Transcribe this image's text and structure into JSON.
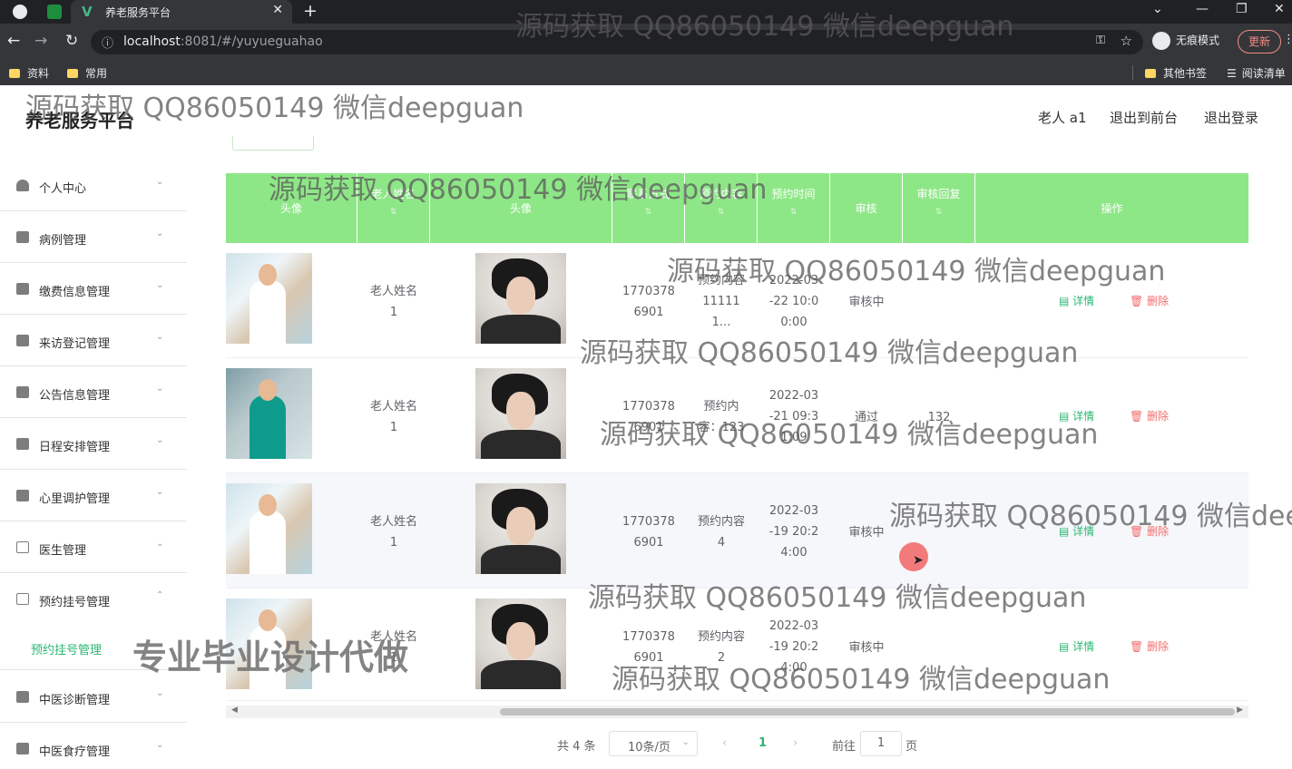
{
  "browser": {
    "tab_title": "养老服务平台",
    "url_host": "localhost",
    "url_rest": ":8081/#/yuyueguahao",
    "incognito_label": "无痕模式",
    "update_label": "更新",
    "bookmarks": [
      "资料",
      "常用"
    ],
    "bookmarks_right": [
      "其他书签",
      "阅读清单"
    ]
  },
  "app": {
    "title": "养老服务平台",
    "user": "老人 a1",
    "back_front": "退出到前台",
    "logout": "退出登录"
  },
  "sidebar": {
    "items": [
      {
        "label": "个人中心",
        "icon": "user-icon"
      },
      {
        "label": "病例管理",
        "icon": "grid-icon"
      },
      {
        "label": "缴费信息管理",
        "icon": "monitor-icon"
      },
      {
        "label": "来访登记管理",
        "icon": "chart-icon"
      },
      {
        "label": "公告信息管理",
        "icon": "briefcase-icon"
      },
      {
        "label": "日程安排管理",
        "icon": "camera-icon"
      },
      {
        "label": "心里调护管理",
        "icon": "clipboard-icon"
      },
      {
        "label": "医生管理",
        "icon": "mail-icon"
      },
      {
        "label": "预约挂号管理",
        "icon": "message-icon"
      },
      {
        "label": "中医诊断管理",
        "icon": "list-icon"
      },
      {
        "label": "中医食疗管理",
        "icon": "monitor-icon"
      }
    ],
    "submenu_active": "预约挂号管理"
  },
  "table": {
    "headers": [
      "头像",
      "老人姓名",
      "头像",
      "联系方式",
      "预约内容",
      "预约时间",
      "审核",
      "审核回复",
      "操作"
    ],
    "rows": [
      {
        "name": [
          "老人姓名",
          "1"
        ],
        "contact": [
          "1770378",
          "6901"
        ],
        "content": [
          "预约内容",
          "11111",
          "1..."
        ],
        "time": [
          "2022-03",
          "-22 10:0",
          "0:00"
        ],
        "status": "审核中",
        "reply": ""
      },
      {
        "name": [
          "老人姓名",
          "1"
        ],
        "contact": [
          "1770378",
          "6901"
        ],
        "content": [
          "预约内",
          "容：123"
        ],
        "time": [
          "2022-03",
          "-21 09:3",
          "1:09"
        ],
        "status": "通过",
        "reply": "132"
      },
      {
        "name": [
          "老人姓名",
          "1"
        ],
        "contact": [
          "1770378",
          "6901"
        ],
        "content": [
          "预约内容",
          "4"
        ],
        "time": [
          "2022-03",
          "-19 20:2",
          "4:00"
        ],
        "status": "审核中",
        "reply": ""
      },
      {
        "name": [
          "老人姓名",
          "1"
        ],
        "contact": [
          "1770378",
          "6901"
        ],
        "content": [
          "预约内容",
          "2"
        ],
        "time": [
          "2022-03",
          "-19 20:2",
          "4:00"
        ],
        "status": "审核中",
        "reply": ""
      }
    ],
    "detail_label": "详情",
    "delete_label": "删除"
  },
  "pagination": {
    "total": "共 4 条",
    "page_size": "10条/页",
    "current": "1",
    "goto_label": "前往",
    "goto_value": "1",
    "page_unit": "页"
  },
  "watermarks": {
    "qq": "源码获取 QQ86050149 微信deepguan",
    "qq_cut": "源码获取 QQ86050149 微信dee",
    "promo": "专业毕业设计代做"
  },
  "colors": {
    "accent": "#2bb673",
    "header_bg": "#8ee787",
    "danger": "#f56c6c"
  }
}
